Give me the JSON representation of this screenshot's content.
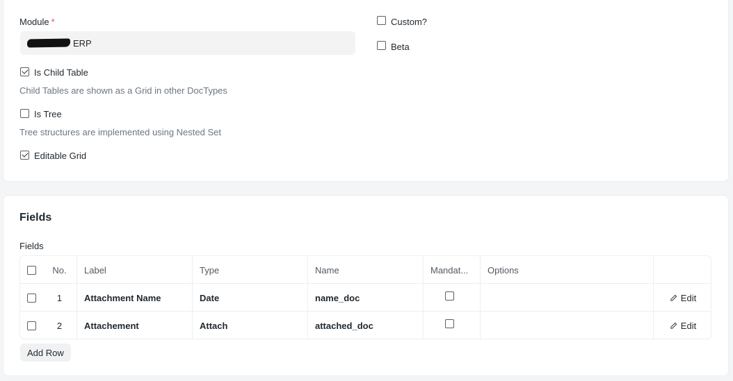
{
  "settings": {
    "module_label": "Module",
    "module_required_mark": "*",
    "module_value": "ERP",
    "custom_label": "Custom?",
    "beta_label": "Beta",
    "is_child_table_label": "Is Child Table",
    "is_child_table_checked": true,
    "is_child_table_desc": "Child Tables are shown as a Grid in other DocTypes",
    "is_tree_label": "Is Tree",
    "is_tree_checked": false,
    "is_tree_desc": "Tree structures are implemented using Nested Set",
    "editable_grid_label": "Editable Grid",
    "editable_grid_checked": true,
    "custom_checked": false,
    "beta_checked": false
  },
  "fields_section": {
    "title": "Fields",
    "grid_label": "Fields",
    "columns": [
      "No.",
      "Label",
      "Type",
      "Name",
      "Mandat...",
      "Options"
    ],
    "rows": [
      {
        "no": "1",
        "label": "Attachment Name",
        "type": "Date",
        "name": "name_doc",
        "mandatory": false,
        "options": "",
        "edit": "Edit"
      },
      {
        "no": "2",
        "label": "Attachement",
        "type": "Attach",
        "name": "attached_doc",
        "mandatory": false,
        "options": "",
        "edit": "Edit"
      }
    ],
    "add_row_label": "Add Row"
  },
  "icons": {
    "edit": "pencil-icon",
    "redaction": "redacted-scribble"
  },
  "colors": {
    "required": "#e24c4c",
    "description": "#6c7680",
    "input_bg": "#f3f3f3"
  }
}
